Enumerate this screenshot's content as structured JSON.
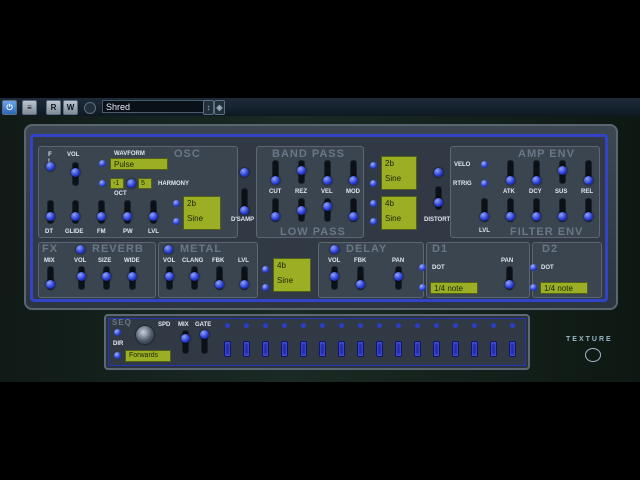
{
  "toolbar": {
    "buttons": [
      "R",
      "W"
    ],
    "preset": "Shred"
  },
  "osc": {
    "title": "OSC",
    "labels": {
      "vol": "VOL",
      "waveform": "WAVFORM",
      "oct": "OCT",
      "harmony": "HARMONY",
      "dt": "DT",
      "glide": "GLIDE",
      "fm": "FM",
      "pw": "PW",
      "lvl": "LVL",
      "voices": "F\nL\nY"
    },
    "waveform": "Pulse",
    "oct_left": "-1",
    "oct_right": "5",
    "osc2_top": "2b",
    "osc2_bottom": "Sine",
    "dsamp": "D'SAMP"
  },
  "filter": {
    "band_pass": "BAND PASS",
    "low_pass": "LOW PASS",
    "labels": [
      "CUT",
      "REZ",
      "VEL",
      "MOD"
    ],
    "lcd1_top": "2b",
    "lcd1_bottom": "Sine",
    "lcd2_top": "4b",
    "lcd2_bottom": "Sine",
    "distort": "DISTORT"
  },
  "amp": {
    "title": "AMP ENV",
    "filter_env": "FILTER ENV",
    "velo": "VELO",
    "rtrig": "RTRIG",
    "labels": [
      "ATK",
      "DCY",
      "SUS",
      "REL"
    ],
    "lvl": "LVL"
  },
  "fx": {
    "title": "FX",
    "labels": [
      "MIX",
      "VOL",
      "SIZE",
      "WIDE"
    ]
  },
  "reverb": {
    "title": "REVERB"
  },
  "metal": {
    "title": "METAL",
    "labels": [
      "VOL",
      "CLANG",
      "FBK",
      "LVL"
    ],
    "lcd_top": "4b",
    "lcd_bottom": "Sine"
  },
  "delay": {
    "title": "DELAY",
    "labels": [
      "VOL",
      "FBK",
      "PAN"
    ]
  },
  "d1": {
    "title": "D1",
    "dot": "DOT",
    "pan": "PAN",
    "time": "1/4 note"
  },
  "d2": {
    "title": "D2",
    "dot": "DOT",
    "time": "1/4 note"
  },
  "seq": {
    "title": "SEQ",
    "dir": "DIR",
    "spd": "SPD",
    "mix": "MIX",
    "gate": "GATE",
    "direction": "Forwards",
    "steps": 16
  },
  "brand": "TEXTURE",
  "colors": {
    "accent": "#2a40d8",
    "lcd": "#9caf24",
    "panel": "#3b4550"
  }
}
